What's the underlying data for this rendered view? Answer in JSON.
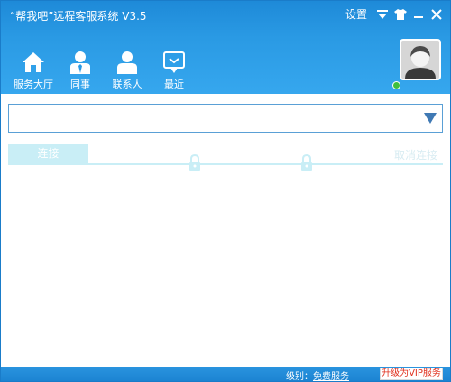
{
  "window": {
    "title": "“帮我吧”远程客服系统 V3.5",
    "settings_label": "设置"
  },
  "nav": {
    "items": [
      {
        "label": "服务大厅",
        "icon": "home-icon"
      },
      {
        "label": "同事",
        "icon": "colleague-icon"
      },
      {
        "label": "联系人",
        "icon": "contact-icon"
      },
      {
        "label": "最近",
        "icon": "recent-chat-icon"
      }
    ]
  },
  "user": {
    "status_color": "#3fbf3f"
  },
  "address": {
    "value": "",
    "placeholder": ""
  },
  "connection": {
    "connect_label": "连接",
    "cancel_label": "取消连接"
  },
  "footer": {
    "level_label": "级别：",
    "level_value": "免费服务",
    "upgrade_label": "升级为VIP服务"
  },
  "colors": {
    "header": "#2a9ae4",
    "accent": "#1a7cc9",
    "upgrade_text": "#e0301e"
  }
}
